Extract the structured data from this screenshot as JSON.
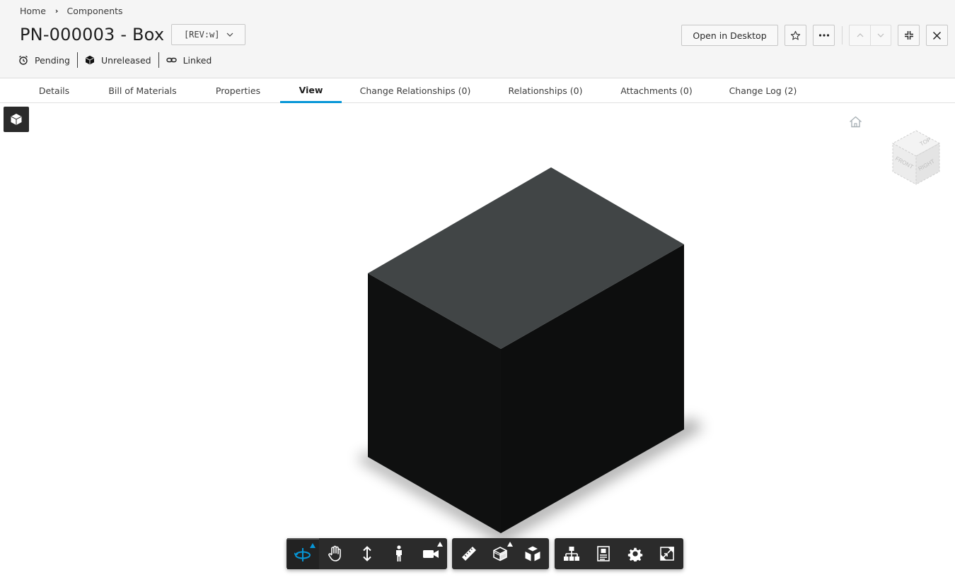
{
  "breadcrumb": {
    "home": "Home",
    "current": "Components"
  },
  "item": {
    "title": "PN-000003 - Box",
    "revision": "[REV:w]"
  },
  "status": {
    "lifecycle": "Pending",
    "release": "Unreleased",
    "link": "Linked"
  },
  "actions": {
    "open_desktop_label": "Open in Desktop",
    "favorite_icon": "star-icon",
    "more_icon": "more-icon",
    "prev_icon": "chevron-up-icon",
    "next_icon": "chevron-down-icon",
    "collapse_icon": "collapse-icon",
    "close_icon": "close-icon"
  },
  "tabs": [
    {
      "label": "Details"
    },
    {
      "label": "Bill of Materials"
    },
    {
      "label": "Properties"
    },
    {
      "label": "View",
      "active": true
    },
    {
      "label": "Change Relationships (0)"
    },
    {
      "label": "Relationships (0)"
    },
    {
      "label": "Attachments (0)"
    },
    {
      "label": "Change Log (2)"
    }
  ],
  "viewcube": {
    "top": "TOP",
    "front": "FRONT",
    "right": "RIGHT"
  },
  "toolbar": {
    "groups": [
      [
        "orbit-icon",
        "pan-icon",
        "zoom-icon",
        "first-person-icon",
        "camera-icon"
      ],
      [
        "measure-icon",
        "section-icon",
        "explode-icon"
      ],
      [
        "model-browser-icon",
        "properties-icon",
        "settings-icon",
        "fullscreen-icon"
      ]
    ],
    "active_tool": "orbit-icon"
  },
  "colors": {
    "accent": "#0696d7",
    "box_top": "#414546",
    "box_sides": "#0f1010",
    "toolbar_bg": "#2b2b2b"
  }
}
